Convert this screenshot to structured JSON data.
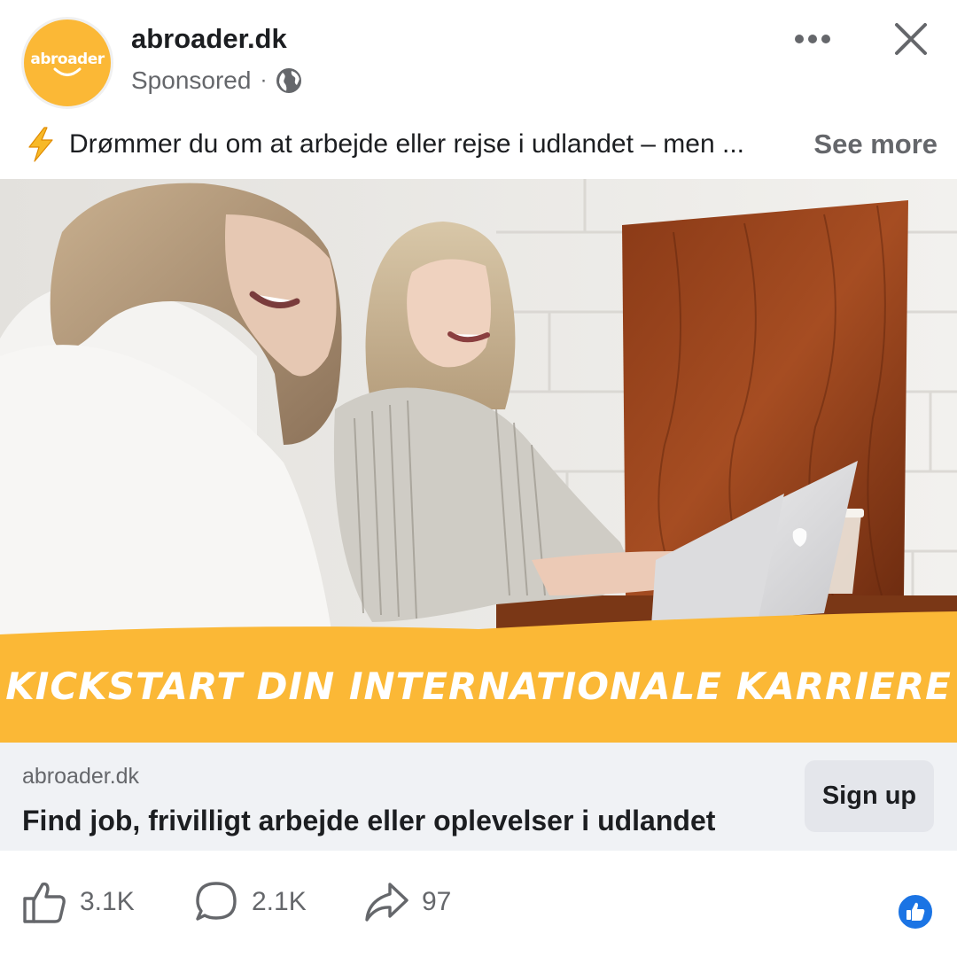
{
  "post": {
    "page_name": "abroader.dk",
    "sponsored_label": "Sponsored",
    "separator": "·",
    "avatar_logo_text": "abroader",
    "caption_text": "Drømmer du om at arbejde eller rejse i udlandet – men ...",
    "see_more": "See more",
    "icons": {
      "more": "more-horizontal-icon",
      "close": "close-icon",
      "audience": "globe-icon",
      "emoji": "lightning-bolt-icon"
    }
  },
  "creative": {
    "banner_text": "Kickstart din internationale karriere",
    "brand_color": "#fbb836"
  },
  "link": {
    "domain": "abroader.dk",
    "headline": "Find job, frivilligt arbejde eller oplevelser i udlandet",
    "cta_label": "Sign up"
  },
  "engagement": {
    "likes": "3.1K",
    "comments": "2.1K",
    "shares": "97",
    "icons": [
      "like-icon",
      "comment-icon",
      "share-icon"
    ],
    "reaction_badge": "like-reaction-icon",
    "reaction_color": "#1b74e4"
  }
}
